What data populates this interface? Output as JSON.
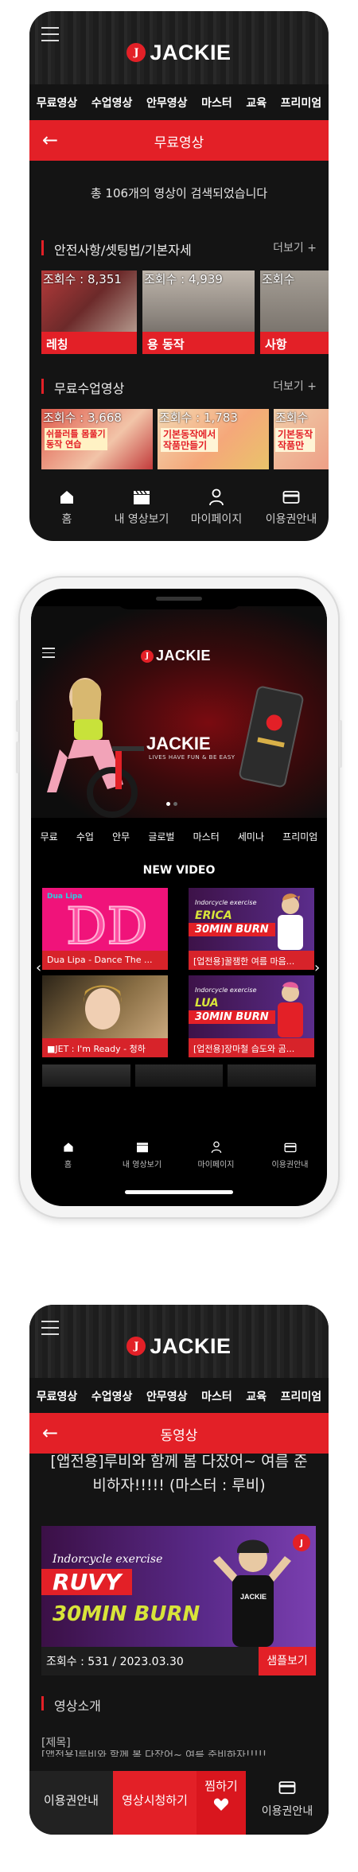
{
  "brand": {
    "name": "JACKIE",
    "mark": "J",
    "slogan": "LIVES HAVE FUN & BE EASY"
  },
  "colors": {
    "accent": "#e32027",
    "bg": "#141414"
  },
  "screen1": {
    "menu": [
      "무료영상",
      "수업영상",
      "안무영상",
      "마스터",
      "교육",
      "프리미엄"
    ],
    "page_title": "무료영상",
    "back_icon": "arrow-left-icon",
    "result_count": "총 106개의 영상이 검색되었습니다",
    "sections": [
      {
        "title": "안전사항/셋팅법/기본자세",
        "more": "더보기 +",
        "items": [
          {
            "views": "조회수 : 8,351",
            "caption": "레칭"
          },
          {
            "views": "조회수 : 4,939",
            "caption": "용 동작"
          },
          {
            "views": "조회수",
            "caption": "사항"
          }
        ]
      },
      {
        "title": "무료수업영상",
        "more": "더보기 +",
        "items": [
          {
            "views": "조회수 : 3,668",
            "overlay": "쉬플러틀 몸풀기\n동작 연습"
          },
          {
            "views": "조회수 : 1,783",
            "overlay": "기본동작에서\n작품만들기"
          },
          {
            "views": "조회수",
            "overlay": "기본동작\n작품만"
          }
        ]
      }
    ],
    "tabbar": [
      {
        "label": "홈",
        "icon": "home-icon"
      },
      {
        "label": "내 영상보기",
        "icon": "clapper-icon"
      },
      {
        "label": "마이페이지",
        "icon": "person-icon"
      },
      {
        "label": "이용권안내",
        "icon": "card-icon"
      }
    ]
  },
  "screen2": {
    "menu": [
      "무료",
      "수업",
      "안무",
      "글로벌",
      "마스터",
      "세미나",
      "프리미엄"
    ],
    "section_title": "NEW VIDEO",
    "cards": [
      {
        "caption": "Dua Lipa - Dance The ...",
        "art": "Dua Lipa"
      },
      {
        "caption": "[업전용]꿀잼한 여름 마음...",
        "art_top": "Indorcycle exercise",
        "art_name": "ERICA",
        "art_sub": "30MIN BURN"
      },
      {
        "caption": "■JET : I'm Ready - 청하",
        "art": ""
      },
      {
        "caption": "[업전용]장마철 습도와 곰...",
        "art_top": "Indorcycle exercise",
        "art_name": "LUA",
        "art_sub": "30MIN BURN"
      }
    ],
    "tabbar": [
      {
        "label": "홈",
        "icon": "home-icon"
      },
      {
        "label": "내 영상보기",
        "icon": "clapper-icon"
      },
      {
        "label": "마이페이지",
        "icon": "person-icon"
      },
      {
        "label": "이용권안내",
        "icon": "card-icon"
      }
    ]
  },
  "screen3": {
    "menu": [
      "무료영상",
      "수업영상",
      "안무영상",
      "마스터",
      "교육",
      "프리미엄"
    ],
    "page_title": "동영상",
    "back_icon": "arrow-left-icon",
    "video_title": "[앱전용]루비와 함께 봄 다잤어~ 여름 준비하자!!!!! (마스터 : 루비)",
    "video_art": {
      "top": "Indorcycle exercise",
      "name": "RUVY",
      "sub": "30MIN BURN"
    },
    "views": "조회수 : 531 / 2023.03.30",
    "sample_button": "샘플보기",
    "info_title": "영상소개",
    "subject_label": "[제목]",
    "description_cut": "[앱전용]루비와 함께 봄 다잤어~ 여름 준비하자!!!!!",
    "bottom": {
      "pass": "이용권안내",
      "watch": "영상시청하기",
      "fav": "찜하기",
      "right": "이용권안내"
    }
  }
}
